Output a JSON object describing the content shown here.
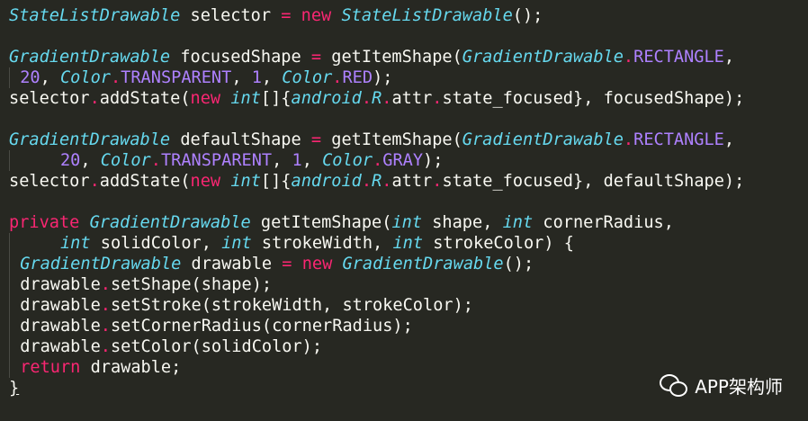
{
  "editor": {
    "colors": {
      "background": "#272822",
      "type": "#66d9ef",
      "keyword": "#f92672",
      "number": "#ae81ff",
      "plain": "#f8f8f2"
    },
    "lines": [
      [
        {
          "t": "StateListDrawable",
          "c": "type"
        },
        {
          "t": " selector ",
          "c": "plain"
        },
        {
          "t": "=",
          "c": "op"
        },
        {
          "t": " ",
          "c": "plain"
        },
        {
          "t": "new",
          "c": "kw"
        },
        {
          "t": " ",
          "c": "plain"
        },
        {
          "t": "StateListDrawable",
          "c": "type"
        },
        {
          "t": "();",
          "c": "plain"
        }
      ],
      [],
      [
        {
          "t": "GradientDrawable",
          "c": "type"
        },
        {
          "t": " focusedShape ",
          "c": "plain"
        },
        {
          "t": "=",
          "c": "op"
        },
        {
          "t": " getItemShape(",
          "c": "plain"
        },
        {
          "t": "GradientDrawable",
          "c": "type"
        },
        {
          "t": ".",
          "c": "op"
        },
        {
          "t": "RECTANGLE",
          "c": "const"
        },
        {
          "t": ",",
          "c": "plain"
        }
      ],
      [
        {
          "t": "  ",
          "c": "plain",
          "guide": true
        },
        {
          "t": "20",
          "c": "num"
        },
        {
          "t": ", ",
          "c": "plain"
        },
        {
          "t": "Color",
          "c": "type"
        },
        {
          "t": ".",
          "c": "op"
        },
        {
          "t": "TRANSPARENT",
          "c": "const"
        },
        {
          "t": ", ",
          "c": "plain"
        },
        {
          "t": "1",
          "c": "num"
        },
        {
          "t": ", ",
          "c": "plain"
        },
        {
          "t": "Color",
          "c": "type"
        },
        {
          "t": ".",
          "c": "op"
        },
        {
          "t": "RED",
          "c": "const"
        },
        {
          "t": ");",
          "c": "plain"
        }
      ],
      [
        {
          "t": "selector",
          "c": "plain"
        },
        {
          "t": ".",
          "c": "op"
        },
        {
          "t": "addState(",
          "c": "plain"
        },
        {
          "t": "new",
          "c": "kw"
        },
        {
          "t": " ",
          "c": "plain"
        },
        {
          "t": "int",
          "c": "prim"
        },
        {
          "t": "[]{",
          "c": "plain"
        },
        {
          "t": "android",
          "c": "type"
        },
        {
          "t": ".",
          "c": "op"
        },
        {
          "t": "R",
          "c": "type"
        },
        {
          "t": ".",
          "c": "op"
        },
        {
          "t": "attr",
          "c": "plain"
        },
        {
          "t": ".",
          "c": "op"
        },
        {
          "t": "state_focused}, focusedShape);",
          "c": "plain"
        }
      ],
      [],
      [
        {
          "t": "GradientDrawable",
          "c": "type"
        },
        {
          "t": " defaultShape ",
          "c": "plain"
        },
        {
          "t": "=",
          "c": "op"
        },
        {
          "t": " getItemShape(",
          "c": "plain"
        },
        {
          "t": "GradientDrawable",
          "c": "type"
        },
        {
          "t": ".",
          "c": "op"
        },
        {
          "t": "RECTANGLE",
          "c": "const"
        },
        {
          "t": ",",
          "c": "plain"
        }
      ],
      [
        {
          "t": "      ",
          "c": "plain",
          "guide": true
        },
        {
          "t": "20",
          "c": "num"
        },
        {
          "t": ", ",
          "c": "plain"
        },
        {
          "t": "Color",
          "c": "type"
        },
        {
          "t": ".",
          "c": "op"
        },
        {
          "t": "TRANSPARENT",
          "c": "const"
        },
        {
          "t": ", ",
          "c": "plain"
        },
        {
          "t": "1",
          "c": "num"
        },
        {
          "t": ", ",
          "c": "plain"
        },
        {
          "t": "Color",
          "c": "type"
        },
        {
          "t": ".",
          "c": "op"
        },
        {
          "t": "GRAY",
          "c": "const"
        },
        {
          "t": ");",
          "c": "plain"
        }
      ],
      [
        {
          "t": "selector",
          "c": "plain"
        },
        {
          "t": ".",
          "c": "op"
        },
        {
          "t": "addState(",
          "c": "plain"
        },
        {
          "t": "new",
          "c": "kw"
        },
        {
          "t": " ",
          "c": "plain"
        },
        {
          "t": "int",
          "c": "prim"
        },
        {
          "t": "[]{",
          "c": "plain"
        },
        {
          "t": "android",
          "c": "type"
        },
        {
          "t": ".",
          "c": "op"
        },
        {
          "t": "R",
          "c": "type"
        },
        {
          "t": ".",
          "c": "op"
        },
        {
          "t": "attr",
          "c": "plain"
        },
        {
          "t": ".",
          "c": "op"
        },
        {
          "t": "state_focused}, defaultShape);",
          "c": "plain"
        }
      ],
      [],
      [
        {
          "t": "private",
          "c": "kw"
        },
        {
          "t": " ",
          "c": "plain"
        },
        {
          "t": "GradientDrawable",
          "c": "type"
        },
        {
          "t": " getItemShape(",
          "c": "plain"
        },
        {
          "t": "int",
          "c": "prim"
        },
        {
          "t": " shape, ",
          "c": "plain"
        },
        {
          "t": "int",
          "c": "prim"
        },
        {
          "t": " cornerRadius,",
          "c": "plain"
        }
      ],
      [
        {
          "t": "      ",
          "c": "plain",
          "guide": true
        },
        {
          "t": "int",
          "c": "prim"
        },
        {
          "t": " solidColor, ",
          "c": "plain"
        },
        {
          "t": "int",
          "c": "prim"
        },
        {
          "t": " strokeWidth, ",
          "c": "plain"
        },
        {
          "t": "int",
          "c": "prim"
        },
        {
          "t": " strokeColor) {",
          "c": "plain"
        }
      ],
      [
        {
          "t": "  ",
          "c": "plain",
          "guide": true
        },
        {
          "t": "GradientDrawable",
          "c": "type"
        },
        {
          "t": " drawable ",
          "c": "plain"
        },
        {
          "t": "=",
          "c": "op"
        },
        {
          "t": " ",
          "c": "plain"
        },
        {
          "t": "new",
          "c": "kw"
        },
        {
          "t": " ",
          "c": "plain"
        },
        {
          "t": "GradientDrawable",
          "c": "type"
        },
        {
          "t": "();",
          "c": "plain"
        }
      ],
      [
        {
          "t": "  ",
          "c": "plain",
          "guide": true
        },
        {
          "t": "drawable",
          "c": "plain"
        },
        {
          "t": ".",
          "c": "op"
        },
        {
          "t": "setShape(shape);",
          "c": "plain"
        }
      ],
      [
        {
          "t": "  ",
          "c": "plain",
          "guide": true
        },
        {
          "t": "drawable",
          "c": "plain"
        },
        {
          "t": ".",
          "c": "op"
        },
        {
          "t": "setStroke(strokeWidth, strokeColor);",
          "c": "plain"
        }
      ],
      [
        {
          "t": "  ",
          "c": "plain",
          "guide": true
        },
        {
          "t": "drawable",
          "c": "plain"
        },
        {
          "t": ".",
          "c": "op"
        },
        {
          "t": "setCornerRadius(cornerRadius);",
          "c": "plain"
        }
      ],
      [
        {
          "t": "  ",
          "c": "plain",
          "guide": true
        },
        {
          "t": "drawable",
          "c": "plain"
        },
        {
          "t": ".",
          "c": "op"
        },
        {
          "t": "setColor(solidColor);",
          "c": "plain"
        }
      ],
      [
        {
          "t": "  ",
          "c": "plain",
          "guide": true
        },
        {
          "t": "return",
          "c": "kw"
        },
        {
          "t": " drawable;",
          "c": "plain"
        }
      ],
      [
        {
          "t": "}",
          "c": "plain",
          "close": true
        }
      ]
    ]
  },
  "watermark": {
    "icon": "wechat-icon",
    "label": "APP架构师"
  }
}
